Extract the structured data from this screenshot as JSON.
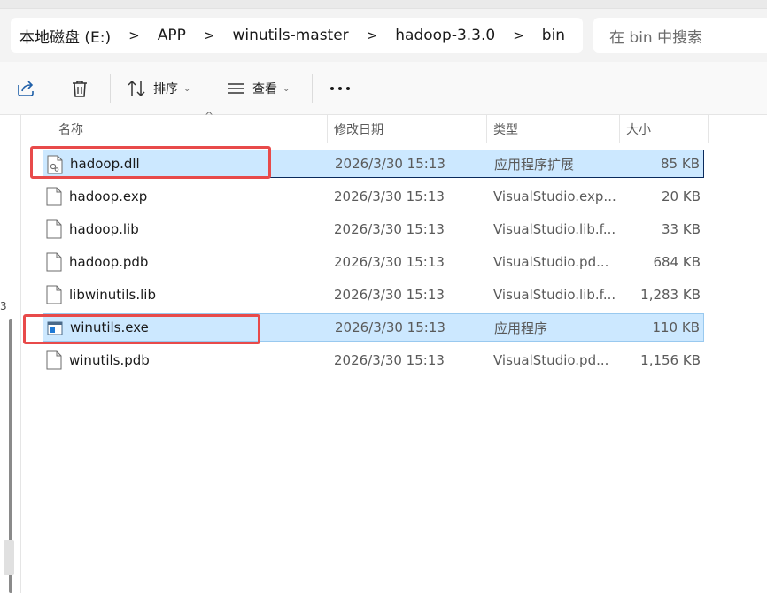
{
  "address": {
    "crumbs": [
      "本地磁盘 (E:)",
      "APP",
      "winutils-master",
      "hadoop-3.3.0",
      "bin"
    ],
    "separator": ">",
    "search_placeholder": "在 bin 中搜索"
  },
  "toolbar": {
    "share_icon": "share-icon",
    "delete_icon": "trash-icon",
    "sort_label": "排序",
    "view_label": "查看",
    "more_label": "•••"
  },
  "columns": {
    "name": "名称",
    "modified": "修改日期",
    "type": "类型",
    "size": "大小"
  },
  "left_pane_fragment": "3",
  "files": [
    {
      "name": "hadoop.dll",
      "modified": "2026/3/30 15:13",
      "type": "应用程序扩展",
      "size": "85 KB",
      "icon": "dll-file-icon",
      "selected": true
    },
    {
      "name": "hadoop.exp",
      "modified": "2026/3/30 15:13",
      "type": "VisualStudio.exp...",
      "size": "20 KB",
      "icon": "file-icon",
      "selected": false
    },
    {
      "name": "hadoop.lib",
      "modified": "2026/3/30 15:13",
      "type": "VisualStudio.lib.f...",
      "size": "33 KB",
      "icon": "file-icon",
      "selected": false
    },
    {
      "name": "hadoop.pdb",
      "modified": "2026/3/30 15:13",
      "type": "VisualStudio.pd...",
      "size": "684 KB",
      "icon": "file-icon",
      "selected": false
    },
    {
      "name": "libwinutils.lib",
      "modified": "2026/3/30 15:13",
      "type": "VisualStudio.lib.f...",
      "size": "1,283 KB",
      "icon": "file-icon",
      "selected": false
    },
    {
      "name": "winutils.exe",
      "modified": "2026/3/30 15:13",
      "type": "应用程序",
      "size": "110 KB",
      "icon": "exe-file-icon",
      "selected": true
    },
    {
      "name": "winutils.pdb",
      "modified": "2026/3/30 15:13",
      "type": "VisualStudio.pd...",
      "size": "1,156 KB",
      "icon": "file-icon",
      "selected": false
    }
  ],
  "colors": {
    "selection_bg": "#cce8ff",
    "annotation_red": "#e84a4a"
  }
}
